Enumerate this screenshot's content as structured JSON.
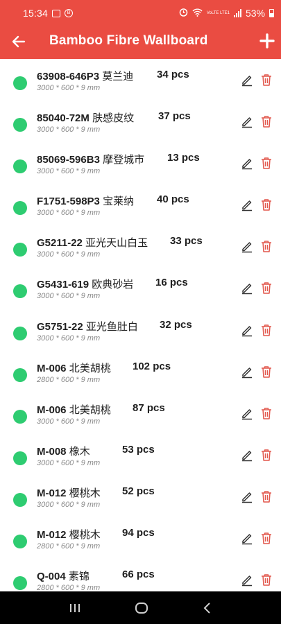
{
  "status_bar": {
    "time": "15:34",
    "net_label": "VoLTE LTE1",
    "battery": "53%"
  },
  "app_bar": {
    "title": "Bamboo Fibre Wallboard",
    "back_icon": "arrow-left-icon",
    "add_icon": "plus-icon"
  },
  "colors": {
    "accent": "#ea4c42",
    "status_dot": "#2ecc71",
    "delete": "#e2574c"
  },
  "items": [
    {
      "code": "63908-646P3",
      "name": "莫兰迪",
      "qty": "34 pcs",
      "dims": "3000 * 600 * 9 mm"
    },
    {
      "code": "85040-72M",
      "name": "肤感皮纹",
      "qty": "37 pcs",
      "dims": "3000 * 600 * 9 mm"
    },
    {
      "code": "85069-596B3",
      "name": "摩登城市",
      "qty": "13 pcs",
      "dims": "3000 * 600 * 9 mm"
    },
    {
      "code": "F1751-598P3",
      "name": "宝莱纳",
      "qty": "40 pcs",
      "dims": "3000 * 600 * 9 mm"
    },
    {
      "code": "G5211-22",
      "name": "亚光天山白玉",
      "qty": "33 pcs",
      "dims": "3000 * 600 * 9 mm"
    },
    {
      "code": "G5431-619",
      "name": "欧典砂岩",
      "qty": "16 pcs",
      "dims": "3000 * 600 * 9 mm"
    },
    {
      "code": "G5751-22",
      "name": "亚光鱼肚白",
      "qty": "32 pcs",
      "dims": "3000 * 600 * 9 mm"
    },
    {
      "code": "M-006",
      "name": "北美胡桃",
      "qty": "102 pcs",
      "dims": "2800 * 600 * 9 mm"
    },
    {
      "code": "M-006",
      "name": "北美胡桃",
      "qty": "87 pcs",
      "dims": "3000 * 600 * 9 mm"
    },
    {
      "code": "M-008",
      "name": "橡木",
      "qty": "53 pcs",
      "dims": "3000 * 600 * 9 mm"
    },
    {
      "code": "M-012",
      "name": "樱桃木",
      "qty": "52 pcs",
      "dims": "3000 * 600 * 9 mm"
    },
    {
      "code": "M-012",
      "name": "樱桃木",
      "qty": "94 pcs",
      "dims": "2800 * 600 * 9 mm"
    },
    {
      "code": "Q-004",
      "name": "素锦",
      "qty": "66 pcs",
      "dims": "2800 * 600 * 9 mm"
    }
  ]
}
